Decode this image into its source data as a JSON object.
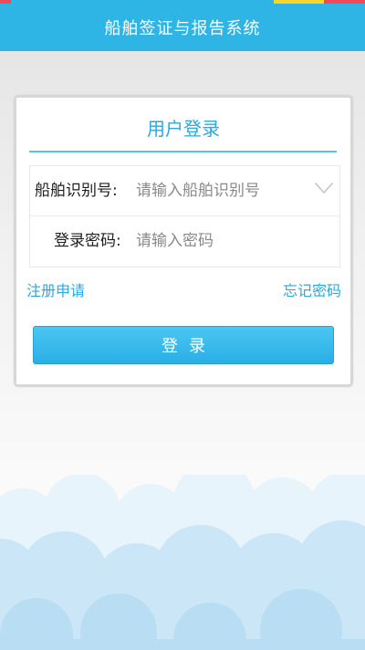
{
  "header": {
    "title": "船舶签证与报告系统",
    "background_color": "#2fb4e6"
  },
  "login": {
    "title": "用户登录",
    "fields": [
      {
        "label": "船舶识别号:",
        "placeholder": "请输入船舶识别号",
        "value": "",
        "icon": "chevron-down-icon"
      },
      {
        "label": "登录密码:",
        "placeholder": "请输入密码",
        "value": ""
      }
    ],
    "register_link": "注册申请",
    "forgot_link": "忘记密码",
    "submit_label": "登录"
  },
  "colors": {
    "accent": "#2ba8df",
    "button": "#2cb2e8",
    "cloud": "#cbe6f7"
  }
}
